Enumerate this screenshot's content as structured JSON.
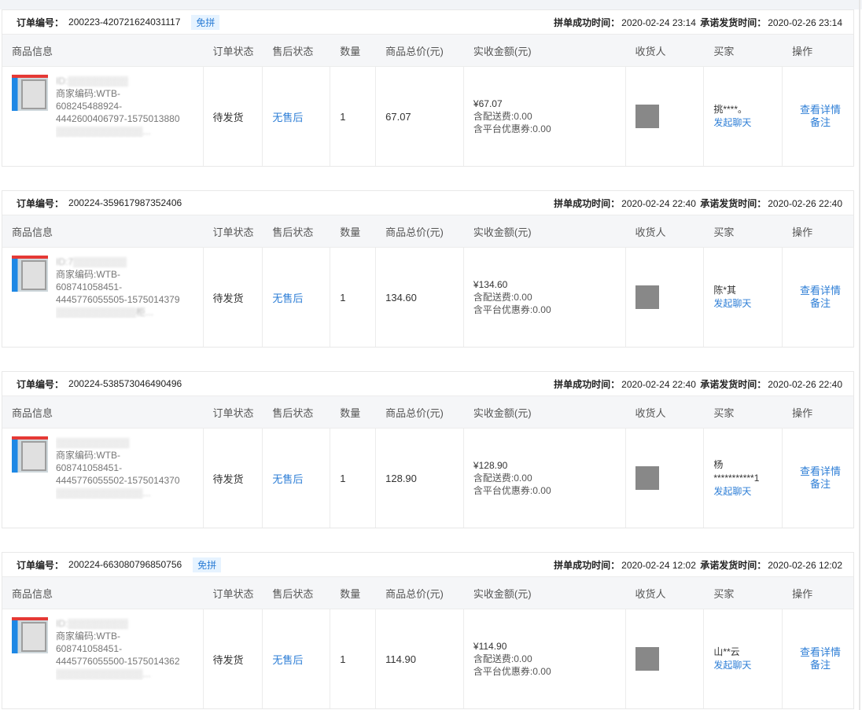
{
  "columns": [
    "商品信息",
    "订单状态",
    "售后状态",
    "数量",
    "商品总价(元)",
    "实收金额(元)",
    "收货人",
    "买家",
    "操作"
  ],
  "labels": {
    "order_no": "订单编号：",
    "group_time": "拼单成功时间：",
    "ship_time": "承诺发货时间：",
    "view_detail": "查看详情",
    "remark": "备注",
    "start_chat": "发起聊天"
  },
  "orders": [
    {
      "order_no": "200223-420721624031117",
      "badge": "免拼",
      "group_time": "2020-02-24 23:14",
      "ship_time": "2020-02-26 23:14",
      "product_id": "ID:▒▒▒▒▒▒▒▒▒",
      "merchant_code": "商家编码:WTB-",
      "code_line2": "608245488924-",
      "code_line3": "4442600406797-1575013880",
      "blur_line": "▒▒▒▒▒▒▒▒▒▒▒▒▒...",
      "status": "待发货",
      "after_sale": "无售后",
      "qty": "1",
      "total": "67.07",
      "received": "¥67.07",
      "shipping": "含配送费:0.00",
      "coupon": "含平台优惠券:0.00",
      "buyer": "挑****。",
      "buyer2": ""
    },
    {
      "order_no": "200224-359617987352406",
      "badge": "",
      "group_time": "2020-02-24 22:40",
      "ship_time": "2020-02-26 22:40",
      "product_id": "ID:7▒▒▒▒▒▒▒▒",
      "merchant_code": "商家编码:WTB-",
      "code_line2": "608741058451-",
      "code_line3": "4445776055505-1575014379",
      "blur_line": "▒▒▒▒▒▒▒▒▒▒▒▒柜...",
      "status": "待发货",
      "after_sale": "无售后",
      "qty": "1",
      "total": "134.60",
      "received": "¥134.60",
      "shipping": "含配送费:0.00",
      "coupon": "含平台优惠券:0.00",
      "buyer": "陈*其",
      "buyer2": ""
    },
    {
      "order_no": "200224-538573046490496",
      "badge": "",
      "group_time": "2020-02-24 22:40",
      "ship_time": "2020-02-26 22:40",
      "product_id": "▒▒▒▒▒▒▒▒▒▒▒",
      "merchant_code": "商家编码:WTB-",
      "code_line2": "608741058451-",
      "code_line3": "4445776055502-1575014370",
      "blur_line": "▒▒▒▒▒▒▒▒▒▒▒▒▒...",
      "status": "待发货",
      "after_sale": "无售后",
      "qty": "1",
      "total": "128.90",
      "received": "¥128.90",
      "shipping": "含配送费:0.00",
      "coupon": "含平台优惠券:0.00",
      "buyer": "杨",
      "buyer2": "***********1"
    },
    {
      "order_no": "200224-663080796850756",
      "badge": "免拼",
      "group_time": "2020-02-24 12:02",
      "ship_time": "2020-02-26 12:02",
      "product_id": "ID:▒▒▒▒▒▒▒▒▒",
      "merchant_code": "商家编码:WTB-",
      "code_line2": "608741058451-",
      "code_line3": "4445776055500-1575014362",
      "blur_line": "▒▒▒▒▒▒▒▒▒▒▒▒▒...",
      "status": "待发货",
      "after_sale": "无售后",
      "qty": "1",
      "total": "114.90",
      "received": "¥114.90",
      "shipping": "含配送费:0.00",
      "coupon": "含平台优惠券:0.00",
      "buyer": "山**云",
      "buyer2": ""
    }
  ]
}
